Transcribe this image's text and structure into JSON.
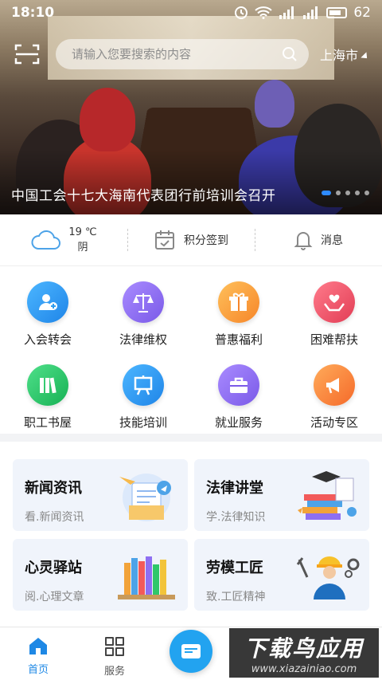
{
  "status_bar": {
    "time": "18:10",
    "battery": "62"
  },
  "header": {
    "search_placeholder": "请输入您要搜索的内容",
    "city": "上海市"
  },
  "banner": {
    "caption": "中国工会十七大海南代表团行前培训会召开",
    "slide_count": 5,
    "active_slide": 1
  },
  "info_strip": {
    "temperature": "19 ℃",
    "weather": "阴",
    "checkin_label": "积分签到",
    "message_label": "消息"
  },
  "services": [
    {
      "label": "入会转会",
      "icon": "add-member-icon",
      "color": "#2f9df0"
    },
    {
      "label": "法律维权",
      "icon": "scales-icon",
      "color": "#8e6ff2"
    },
    {
      "label": "普惠福利",
      "icon": "gift-icon",
      "color": "#f9a13b"
    },
    {
      "label": "困难帮扶",
      "icon": "heart-hands-icon",
      "color": "#f1556a"
    },
    {
      "label": "职工书屋",
      "icon": "books-icon",
      "color": "#2fc76a"
    },
    {
      "label": "技能培训",
      "icon": "easel-icon",
      "color": "#2f9df0"
    },
    {
      "label": "就业服务",
      "icon": "briefcase-icon",
      "color": "#8e6ff2"
    },
    {
      "label": "活动专区",
      "icon": "megaphone-icon",
      "color": "#f98a3b"
    }
  ],
  "cards": [
    {
      "title": "新闻资讯",
      "subtitle": "看.新闻资讯",
      "icon": "newspaper-icon"
    },
    {
      "title": "法律讲堂",
      "subtitle": "学.法律知识",
      "icon": "graduation-books-icon"
    },
    {
      "title": "心灵驿站",
      "subtitle": "阅.心理文章",
      "icon": "bookshelf-icon"
    },
    {
      "title": "劳模工匠",
      "subtitle": "致.工匠精神",
      "icon": "worker-icon"
    }
  ],
  "nav": {
    "home": "首页",
    "services": "服务"
  },
  "watermark": {
    "main": "下载鸟应用",
    "sub": "www.xiazainiao.com"
  }
}
